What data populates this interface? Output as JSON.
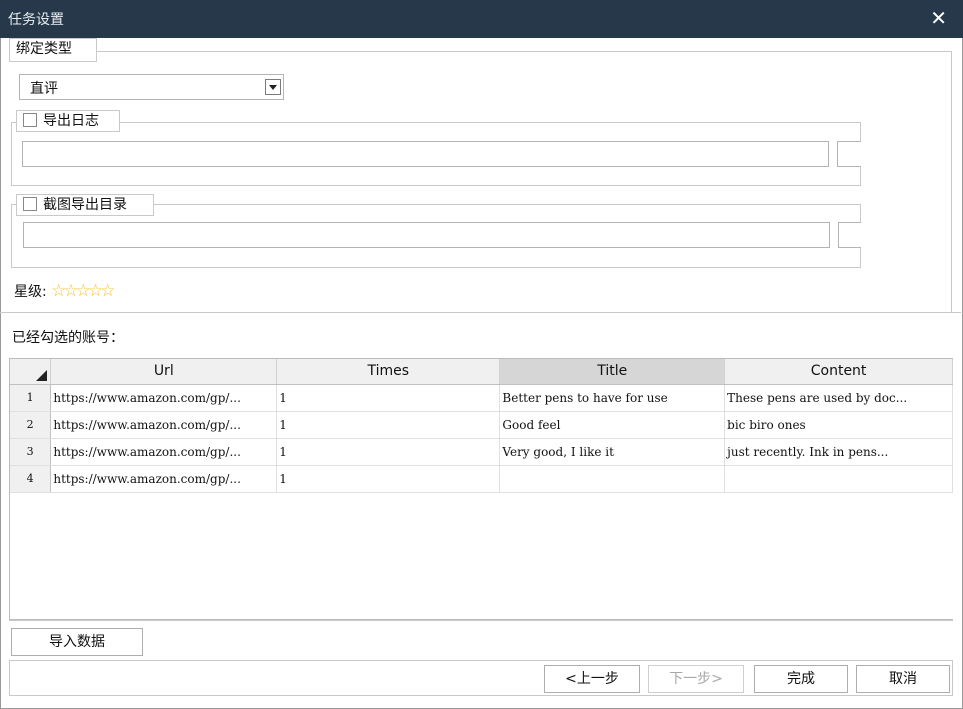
{
  "window": {
    "title": "任务设置",
    "close_glyph": "✕"
  },
  "bind_type": {
    "legend": "绑定类型",
    "selected": "直评"
  },
  "export_log": {
    "label": "导出日志",
    "checked": false,
    "path": ""
  },
  "screenshot_dir": {
    "label": "截图导出目录",
    "checked": false,
    "path": ""
  },
  "rating": {
    "label": "星级:",
    "stars": 5,
    "filled": 0
  },
  "accounts_label": "已经勾选的账号：",
  "grid": {
    "columns": [
      "Url",
      "Times",
      "Title",
      "Content"
    ],
    "selected_column": "Title",
    "rows": [
      {
        "n": "1",
        "url": "https://www.amazon.com/gp/...",
        "times": "1",
        "title": " Better pens to have for use",
        "content": "These pens are used by doc..."
      },
      {
        "n": "2",
        "url": "https://www.amazon.com/gp/...",
        "times": "1",
        "title": "Good feel",
        "content": "bic biro ones"
      },
      {
        "n": "3",
        "url": "https://www.amazon.com/gp/...",
        "times": "1",
        "title": "Very good, I like it",
        "content": "just recently. Ink in pens..."
      },
      {
        "n": "4",
        "url": "https://www.amazon.com/gp/...",
        "times": "1",
        "title": "",
        "content": ""
      }
    ]
  },
  "buttons": {
    "import": "导入数据",
    "prev": "<上一步",
    "next": "下一步>",
    "finish": "完成",
    "cancel": "取消"
  },
  "colors": {
    "titlebar": "#263849",
    "star": "#f1c232"
  }
}
